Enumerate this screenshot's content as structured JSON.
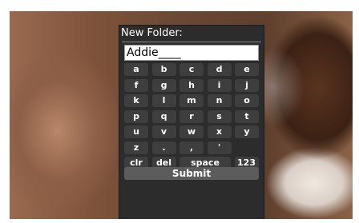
{
  "dialog": {
    "title": "New Folder:",
    "input_value": "Addie____",
    "submit_label": "Submit"
  },
  "keyboard": {
    "rows": [
      [
        "a",
        "b",
        "c",
        "d",
        "e"
      ],
      [
        "f",
        "g",
        "h",
        "i",
        "j"
      ],
      [
        "k",
        "l",
        "m",
        "n",
        "o"
      ],
      [
        "p",
        "q",
        "r",
        "s",
        "t"
      ],
      [
        "u",
        "v",
        "w",
        "x",
        "y"
      ],
      [
        "z",
        ".",
        ",",
        "'"
      ]
    ],
    "controls": [
      "clr",
      "del",
      "space",
      "123"
    ]
  },
  "colors": {
    "dialog_bg": "#2c2c2c",
    "key_bg": "#3e3e3e",
    "submit_bg": "#5c5c5c"
  }
}
